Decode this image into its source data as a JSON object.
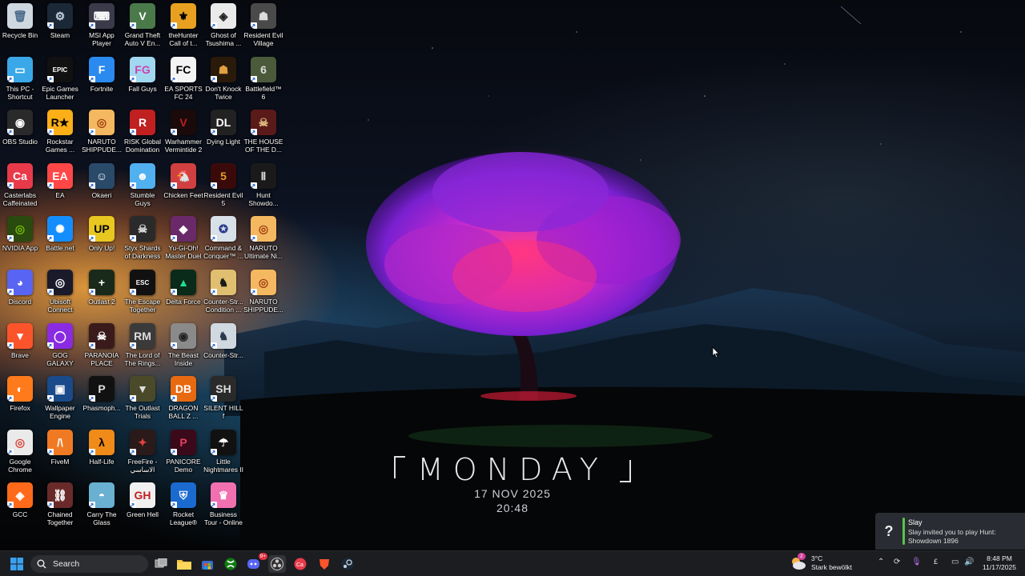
{
  "desktop": {
    "icons": [
      {
        "label": "Recycle Bin",
        "bg": "#cfd8e0",
        "fg": "#4a6a8a",
        "glyph": "🗑",
        "shortcut": false
      },
      {
        "label": "This PC - Shortcut",
        "bg": "#3aa8e8",
        "fg": "#fff",
        "glyph": "▭",
        "shortcut": true
      },
      {
        "label": "OBS Studio",
        "bg": "#2a2a2a",
        "fg": "#fff",
        "glyph": "◉",
        "shortcut": true
      },
      {
        "label": "Casterlabs Caffeinated",
        "bg": "#e83a4a",
        "fg": "#fff",
        "glyph": "Ca",
        "shortcut": true
      },
      {
        "label": "NVIDIA App",
        "bg": "#2a4a10",
        "fg": "#76b900",
        "glyph": "◎",
        "shortcut": true
      },
      {
        "label": "Discord",
        "bg": "#5865f2",
        "fg": "#fff",
        "glyph": "◕",
        "shortcut": true
      },
      {
        "label": "Brave",
        "bg": "#fb542b",
        "fg": "#fff",
        "glyph": "▼",
        "shortcut": true
      },
      {
        "label": "Firefox",
        "bg": "#ff7a1a",
        "fg": "#fff",
        "glyph": "◐",
        "shortcut": true
      },
      {
        "label": "Google Chrome",
        "bg": "#eaeaea",
        "fg": "#db4437",
        "glyph": "◎",
        "shortcut": true
      },
      {
        "label": "GCC",
        "bg": "#ff6a1a",
        "fg": "#fff",
        "glyph": "◈",
        "shortcut": true
      },
      {
        "label": "Steam",
        "bg": "#1b2838",
        "fg": "#c7d5e0",
        "glyph": "⚙",
        "shortcut": true
      },
      {
        "label": "Epic Games Launcher",
        "bg": "#111",
        "fg": "#fff",
        "glyph": "EPIC",
        "shortcut": true
      },
      {
        "label": "Rockstar Games ...",
        "bg": "#fcaf17",
        "fg": "#000",
        "glyph": "R★",
        "shortcut": true
      },
      {
        "label": "EA",
        "bg": "#ff4747",
        "fg": "#fff",
        "glyph": "EA",
        "shortcut": true
      },
      {
        "label": "Battle.net",
        "bg": "#148eff",
        "fg": "#fff",
        "glyph": "✺",
        "shortcut": true
      },
      {
        "label": "Ubisoft Connect",
        "bg": "#1a1a2a",
        "fg": "#fff",
        "glyph": "◎",
        "shortcut": true
      },
      {
        "label": "GOG GALAXY",
        "bg": "#8a2be2",
        "fg": "#fff",
        "glyph": "◯",
        "shortcut": true
      },
      {
        "label": "Wallpaper Engine",
        "bg": "#1a4a8a",
        "fg": "#fff",
        "glyph": "▣",
        "shortcut": true
      },
      {
        "label": "FiveM",
        "bg": "#f07a24",
        "fg": "#fff",
        "glyph": "/\\",
        "shortcut": true
      },
      {
        "label": "Chained Together",
        "bg": "#6a2a2a",
        "fg": "#fff",
        "glyph": "⛓",
        "shortcut": true
      },
      {
        "label": "MSI App Player",
        "bg": "#3a3a4a",
        "fg": "#fff",
        "glyph": "⌨",
        "shortcut": true
      },
      {
        "label": "Fortnite",
        "bg": "#2a8af0",
        "fg": "#fff",
        "glyph": "F",
        "shortcut": true
      },
      {
        "label": "NARUTO SHIPPUDE...",
        "bg": "#f4b860",
        "fg": "#a04010",
        "glyph": "◎",
        "shortcut": true
      },
      {
        "label": "Okaeri",
        "bg": "#2a4a6a",
        "fg": "#fff",
        "glyph": "☺",
        "shortcut": true
      },
      {
        "label": "Only Up!",
        "bg": "#e8c820",
        "fg": "#000",
        "glyph": "UP",
        "shortcut": true
      },
      {
        "label": "Outlast 2",
        "bg": "#1a2a1a",
        "fg": "#fff",
        "glyph": "+",
        "shortcut": true
      },
      {
        "label": "PARANOIA PLACE",
        "bg": "#3a1a1a",
        "fg": "#fff",
        "glyph": "☠",
        "shortcut": true
      },
      {
        "label": "Phasmoph...",
        "bg": "#111",
        "fg": "#ddd",
        "glyph": "P",
        "shortcut": true
      },
      {
        "label": "Half-Life",
        "bg": "#f08a18",
        "fg": "#000",
        "glyph": "λ",
        "shortcut": true
      },
      {
        "label": "Carry The Glass",
        "bg": "#6ab0d0",
        "fg": "#fff",
        "glyph": "◓",
        "shortcut": true
      },
      {
        "label": "Grand Theft Auto V En...",
        "bg": "#4a7a4a",
        "fg": "#fff",
        "glyph": "V",
        "shortcut": true
      },
      {
        "label": "Fall Guys",
        "bg": "#a0d8f0",
        "fg": "#d040b0",
        "glyph": "FG",
        "shortcut": true
      },
      {
        "label": "RISK Global Domination",
        "bg": "#c02020",
        "fg": "#fff",
        "glyph": "R",
        "shortcut": true
      },
      {
        "label": "Stumble Guys",
        "bg": "#50b0f0",
        "fg": "#fff",
        "glyph": "☻",
        "shortcut": true
      },
      {
        "label": "Styx Shards of Darkness",
        "bg": "#2a2a2a",
        "fg": "#ddd",
        "glyph": "☠",
        "shortcut": true
      },
      {
        "label": "The Escape Together",
        "bg": "#111",
        "fg": "#fff",
        "glyph": "ESC",
        "shortcut": true
      },
      {
        "label": "The Lord of The Rings...",
        "bg": "#3a3a3a",
        "fg": "#ddd",
        "glyph": "RM",
        "shortcut": true
      },
      {
        "label": "The Outlast Trials",
        "bg": "#4a4a2a",
        "fg": "#ddd",
        "glyph": "▼",
        "shortcut": true
      },
      {
        "label": "FreeFire - الاساسي",
        "bg": "#2a1a1a",
        "fg": "#e84040",
        "glyph": "✦",
        "shortcut": true
      },
      {
        "label": "Green Hell",
        "bg": "#f0f0f0",
        "fg": "#c02020",
        "glyph": "GH",
        "shortcut": true
      },
      {
        "label": "theHunter Call of t...",
        "bg": "#e8a020",
        "fg": "#000",
        "glyph": "⚜",
        "shortcut": true
      },
      {
        "label": "EA SPORTS FC 24",
        "bg": "#f4f4f4",
        "fg": "#000",
        "glyph": "FC",
        "shortcut": true
      },
      {
        "label": "Warhammer Vermintide 2",
        "bg": "#1a0a0a",
        "fg": "#c02020",
        "glyph": "V",
        "shortcut": true
      },
      {
        "label": "Chicken Feet",
        "bg": "#d04040",
        "fg": "#fff",
        "glyph": "🐔",
        "shortcut": true
      },
      {
        "label": "Yu-Gi-Oh! Master Duel",
        "bg": "#6a2a6a",
        "fg": "#fff",
        "glyph": "◆",
        "shortcut": true
      },
      {
        "label": "Delta Force",
        "bg": "#0a2a1a",
        "fg": "#20e090",
        "glyph": "▲",
        "shortcut": true
      },
      {
        "label": "The Beast Inside",
        "bg": "#8a8a8a",
        "fg": "#222",
        "glyph": "◉",
        "shortcut": true
      },
      {
        "label": "DRAGON BALL Z ...",
        "bg": "#e86a10",
        "fg": "#fff",
        "glyph": "DB",
        "shortcut": true
      },
      {
        "label": "PANICORE Demo",
        "bg": "#3a0a1a",
        "fg": "#e04060",
        "glyph": "P",
        "shortcut": true
      },
      {
        "label": "Rocket League®",
        "bg": "#1a6ad0",
        "fg": "#fff",
        "glyph": "⛨",
        "shortcut": true
      },
      {
        "label": "Ghost of Tsushima ...",
        "bg": "#eaeaea",
        "fg": "#222",
        "glyph": "◈",
        "shortcut": true
      },
      {
        "label": "Don't Knock Twice",
        "bg": "#2a1a0a",
        "fg": "#e0a040",
        "glyph": "☗",
        "shortcut": true
      },
      {
        "label": "Dying Light",
        "bg": "#222",
        "fg": "#fff",
        "glyph": "DL",
        "shortcut": true
      },
      {
        "label": "Resident Evil 5",
        "bg": "#3a0a0a",
        "fg": "#e0a020",
        "glyph": "5",
        "shortcut": true
      },
      {
        "label": "Command & Conquer™ ...",
        "bg": "#d8e0e8",
        "fg": "#2a3a8a",
        "glyph": "✪",
        "shortcut": true
      },
      {
        "label": "Counter-Str... Condition ...",
        "bg": "#e0c070",
        "fg": "#1a1a1a",
        "glyph": "♞",
        "shortcut": true
      },
      {
        "label": "Counter-Str...",
        "bg": "#d0d8e0",
        "fg": "#2a3a4a",
        "glyph": "♞",
        "shortcut": true
      },
      {
        "label": "SILENT HILL f",
        "bg": "#2a2a2a",
        "fg": "#ddd",
        "glyph": "SH",
        "shortcut": true
      },
      {
        "label": "Little Nightmares II",
        "bg": "#111",
        "fg": "#fff",
        "glyph": "☂",
        "shortcut": true
      },
      {
        "label": "Business Tour - Online M...",
        "bg": "#f070b0",
        "fg": "#fff",
        "glyph": "♛",
        "shortcut": true
      },
      {
        "label": "Resident Evil Village",
        "bg": "#4a4a4a",
        "fg": "#ddd",
        "glyph": "☗",
        "shortcut": true
      },
      {
        "label": "Battlefield™ 6",
        "bg": "#4a5a3a",
        "fg": "#ddd",
        "glyph": "6",
        "shortcut": true
      },
      {
        "label": "THE HOUSE OF THE D...",
        "bg": "#5a1a1a",
        "fg": "#e0c080",
        "glyph": "☠",
        "shortcut": true
      },
      {
        "label": "Hunt Showdo...",
        "bg": "#1a1a1a",
        "fg": "#ddd",
        "glyph": "Ⅱ",
        "shortcut": true
      },
      {
        "label": "NARUTO Ultimate Ni...",
        "bg": "#f4b860",
        "fg": "#a04010",
        "glyph": "◎",
        "shortcut": true
      },
      {
        "label": "NARUTO SHIPPUDE...",
        "bg": "#f4b860",
        "fg": "#a04010",
        "glyph": "◎",
        "shortcut": true
      }
    ]
  },
  "widget": {
    "day": "MONDAY",
    "date": "17 NOV 2025",
    "time": "20:48"
  },
  "notification": {
    "title": "Slay",
    "message": "Slay invited you to play Hunt: Showdown 1896",
    "icon": "question-icon",
    "accent": "#59c44a"
  },
  "taskbar": {
    "search_placeholder": "Search",
    "apps": [
      "start-icon",
      "search-icon",
      "task-view-icon",
      "file-explorer-icon",
      "store-icon",
      "xbox-icon",
      "discord-icon",
      "obs-icon",
      "casterlabs-icon",
      "brave-icon",
      "steam-icon"
    ],
    "discord_badge": "9+",
    "weather": {
      "badge": "2",
      "temp": "3°C",
      "condition": "Stark bewölkt"
    },
    "clock": {
      "time": "8:48 PM",
      "date": "11/17/2025"
    }
  }
}
